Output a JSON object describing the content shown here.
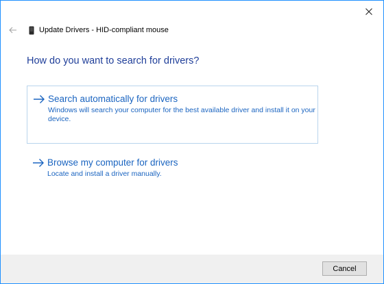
{
  "window": {
    "header_title": "Update Drivers - HID-compliant mouse",
    "accent_color": "#1e90ff"
  },
  "icons": {
    "close": "close-icon",
    "back": "back-arrow-icon",
    "device": "device-icon",
    "option_arrow": "right-arrow-icon"
  },
  "main": {
    "question": "How do you want to search for drivers?",
    "options": [
      {
        "title": "Search automatically for drivers",
        "description": "Windows will search your computer for the best available driver and install it on your device.",
        "selected": true
      },
      {
        "title": "Browse my computer for drivers",
        "description": "Locate and install a driver manually.",
        "selected": false
      }
    ]
  },
  "footer": {
    "cancel_label": "Cancel"
  }
}
